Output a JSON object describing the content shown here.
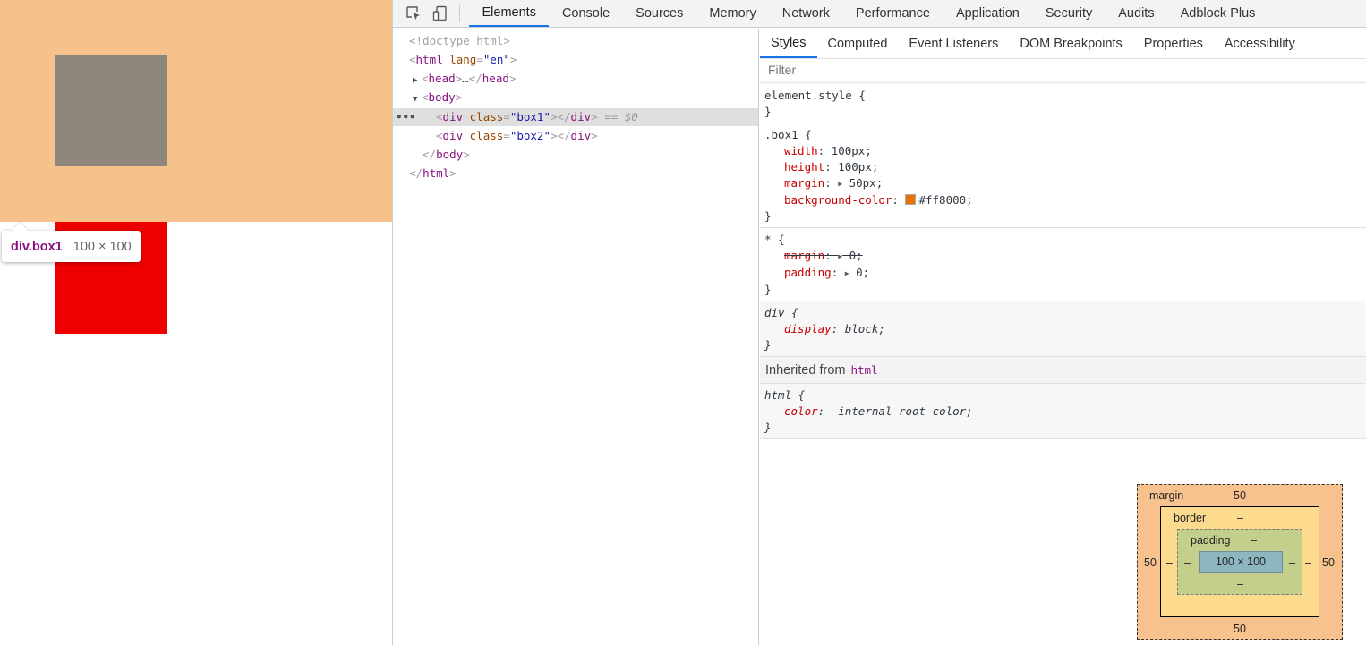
{
  "preview": {
    "tooltip_tag": "div",
    "tooltip_class": ".box1",
    "tooltip_size": "100 × 100",
    "colors": {
      "margin_highlight": "#f7c18c",
      "content_highlight": "#8e867c",
      "box2": "#ef0000"
    }
  },
  "toolbar": {
    "icons": [
      "inspect-element-icon",
      "device-toolbar-icon"
    ],
    "tabs": [
      "Elements",
      "Console",
      "Sources",
      "Memory",
      "Network",
      "Performance",
      "Application",
      "Security",
      "Audits",
      "Adblock Plus"
    ],
    "active_tab": "Elements"
  },
  "dom": {
    "doctype": "<!doctype html>",
    "html_open_tag": "html",
    "html_attr": "lang",
    "html_attr_val": "\"en\"",
    "head_tag": "head",
    "head_collapsed": "…",
    "body_tag": "body",
    "div_tag": "div",
    "class_attr": "class",
    "box1_val": "\"box1\"",
    "box2_val": "\"box2\"",
    "selected_marker": "== $0",
    "dots": "•••"
  },
  "styles": {
    "subtabs": [
      "Styles",
      "Computed",
      "Event Listeners",
      "DOM Breakpoints",
      "Properties",
      "Accessibility"
    ],
    "active_subtab": "Styles",
    "filter_placeholder": "Filter",
    "element_style": "element.style",
    "box1_selector": ".box1",
    "box1_width_prop": "width",
    "box1_width_val": "100px",
    "box1_height_prop": "height",
    "box1_height_val": "100px",
    "box1_margin_prop": "margin",
    "box1_margin_val": "50px",
    "box1_bg_prop": "background-color",
    "box1_bg_val": "#ff8000",
    "box1_swatch_color": "#e8710a",
    "star_selector": "*",
    "star_margin_prop": "margin",
    "star_margin_val": "0",
    "star_padding_prop": "padding",
    "star_padding_val": "0",
    "div_selector": "div",
    "div_display_prop": "display",
    "div_display_val": "block",
    "inherited_label": "Inherited from",
    "inherited_tag": "html",
    "html_selector": "html",
    "html_color_prop": "color",
    "html_color_val": "-internal-root-color"
  },
  "box_model": {
    "margin_label": "margin",
    "margin_top": "50",
    "margin_bottom": "50",
    "margin_left": "50",
    "margin_right": "50",
    "border_label": "border",
    "border_top": "–",
    "border_bottom": "–",
    "border_left": "–",
    "border_right": "–",
    "padding_label": "padding",
    "padding_top": "–",
    "padding_bottom": "–",
    "padding_left": "–",
    "padding_right": "–",
    "content": "100 × 100"
  }
}
